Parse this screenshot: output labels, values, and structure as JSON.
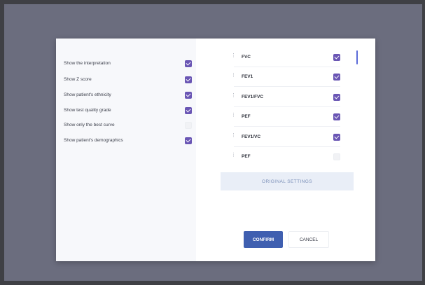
{
  "options": [
    {
      "label": "Show the interpretation",
      "checked": true
    },
    {
      "label": "Show Z score",
      "checked": true
    },
    {
      "label": "Show patient's ethnicity",
      "checked": true
    },
    {
      "label": "Show test quality grade",
      "checked": true
    },
    {
      "label": "Show only the best curve",
      "checked": false
    },
    {
      "label": "Show patient's demographics",
      "checked": true
    }
  ],
  "parameters": [
    {
      "name": "FVC",
      "checked": true
    },
    {
      "name": "FEV1",
      "checked": true
    },
    {
      "name": "FEV1/FVC",
      "checked": true
    },
    {
      "name": "PEF",
      "checked": true
    },
    {
      "name": "FEV1/VC",
      "checked": true
    },
    {
      "name": "PEF",
      "checked": false
    }
  ],
  "buttons": {
    "original_settings": "ORIGINAL SETTINGS",
    "confirm": "CONFIRM",
    "cancel": "CANCEL"
  },
  "colors": {
    "accent": "#6a56b4",
    "primary_button": "#3f5fb0",
    "backdrop": "#6b6d7e"
  }
}
